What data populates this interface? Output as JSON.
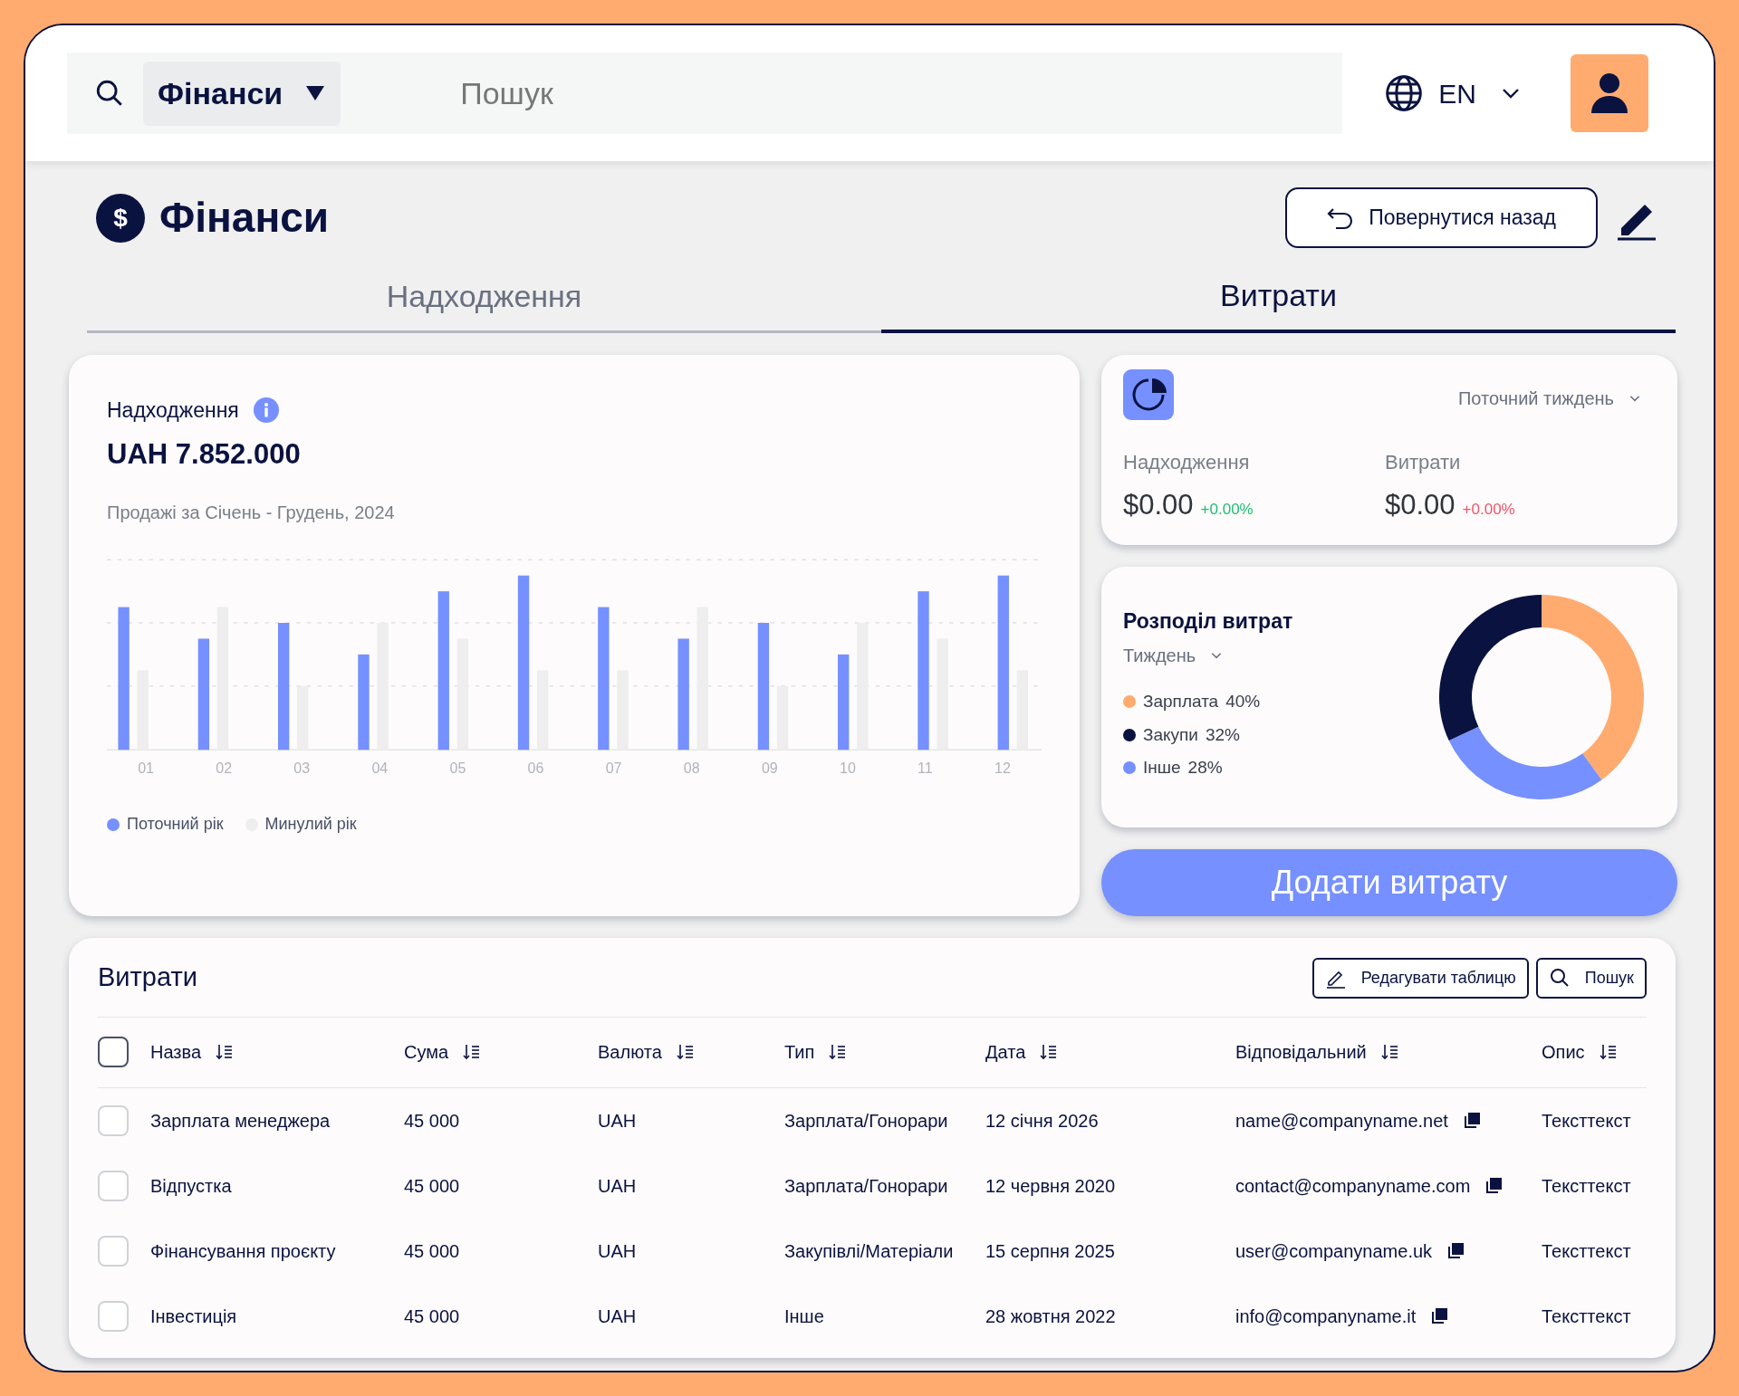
{
  "header": {
    "scope": {
      "label": "Фінанси"
    },
    "search": {
      "placeholder": "Пошук"
    },
    "language": "EN"
  },
  "page": {
    "icon_symbol": "$",
    "title": "Фінанси",
    "back_button": "Повернутися назад"
  },
  "tabs": [
    {
      "label": "Надходження",
      "selected": false
    },
    {
      "label": "Витрати",
      "selected": true
    }
  ],
  "income_card": {
    "title": "Надходження",
    "total": "UAH 7.852.000",
    "subtitle": "Продажі за Січень - Грудень, 2024",
    "x_labels": [
      "01",
      "02",
      "03",
      "04",
      "05",
      "06",
      "07",
      "08",
      "09",
      "10",
      "11",
      "12"
    ],
    "legend": [
      {
        "label": "Поточний рік",
        "color": "#7690ff"
      },
      {
        "label": "Минулий рік",
        "color": "#eeeeee"
      }
    ]
  },
  "summary_card": {
    "period": "Поточний тиждень",
    "stats": [
      {
        "label": "Надходження",
        "amount": "$0.00",
        "change": "+0.00%",
        "color": "#1fbf75"
      },
      {
        "label": "Витрати",
        "amount": "$0.00",
        "change": "+0.00%",
        "color": "#f2546a"
      }
    ]
  },
  "distribution_card": {
    "title": "Розподіл витрат",
    "period": "Тиждень",
    "legend": [
      {
        "label": "Зарплата",
        "percent": "40%",
        "color": "#ffab70"
      },
      {
        "label": "Закупи",
        "percent": "32%",
        "color": "#0a1240"
      },
      {
        "label": "Інше",
        "percent": "28%",
        "color": "#7690ff"
      }
    ],
    "chart_data": {
      "type": "donut",
      "values": [
        40,
        32,
        28
      ]
    }
  },
  "add_button": "Додати витрату",
  "table": {
    "title": "Витрати",
    "actions": [
      {
        "label": "Редагувати таблицю",
        "kind": "edit"
      },
      {
        "label": "Пошук",
        "kind": "search"
      }
    ],
    "select_all": {
      "checked": false
    },
    "columns": [
      "Назва",
      "Сума",
      "Валюта",
      "Тип",
      "Дата",
      "Відповідальний",
      "Опис"
    ],
    "rows": [
      {
        "checked": false,
        "cells": [
          "Зарплата менеджера",
          "45 000",
          "UAH",
          "Зарплата/Гонорари",
          "12 січня 2026",
          "name@companyname.net",
          "Тексттекст"
        ]
      },
      {
        "checked": false,
        "cells": [
          "Відпустка",
          "45 000",
          "UAH",
          "Зарплата/Гонорари",
          "12 червня 2020",
          "contact@companyname.com",
          "Тексттекст"
        ]
      },
      {
        "checked": false,
        "cells": [
          "Фінансування проєкту",
          "45 000",
          "UAH",
          "Закупівлі/Матеріали",
          "15 серпня 2025",
          "user@companyname.uk",
          "Тексттекст"
        ]
      },
      {
        "checked": false,
        "cells": [
          "Інвестиція",
          "45 000",
          "UAH",
          "Інше",
          "28 жовтня 2022",
          "info@companyname.it",
          "Тексттекст"
        ]
      }
    ]
  }
}
